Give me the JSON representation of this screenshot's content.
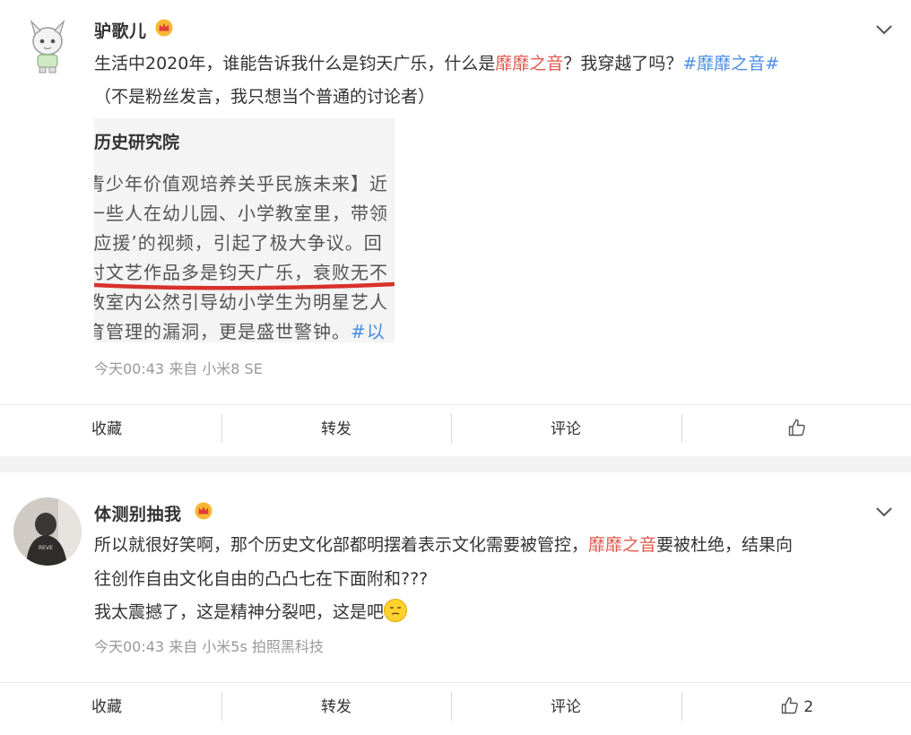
{
  "post1": {
    "username": "驴歌儿",
    "text_a": "生活中2020年，谁能告诉我什么是钧天广乐，什么是",
    "tag_inline": "靡靡之音",
    "text_b": "？我穿越了吗？",
    "hashtag": "#靡靡之音#",
    "line2": "（不是粉丝发言，我只想当个普通的讨论者）",
    "image": {
      "heading": "历史研究院",
      "lines": [
        "青少年价值观培养关乎民族未来】近",
        "一些人在幼儿园、小学教室里，带领",
        "‘应援’的视频，引起了极大争议。回",
        "讨文艺作品多是钧天广乐，衰败无不",
        "教室内公然引导幼小学生为明星艺人",
        "育管理的漏洞，更是盛世警钟。"
      ],
      "link_fragment": "#以"
    },
    "meta": "今天00:43  来自 小米8 SE",
    "actions": {
      "collect": "收藏",
      "forward": "转发",
      "comment": "评论",
      "like_count": ""
    }
  },
  "post2": {
    "username": "体测别抽我",
    "line1_a": "所以就很好笑啊，那个历史文化部都明摆着表示文化需要被管控，",
    "line1_tag": "靡靡之音",
    "line1_b": "要被杜绝，结果向",
    "line2": "往创作自由文化自由的凸凸七在下面附和???",
    "line3": "我太震撼了，这是精神分裂吧，这是吧",
    "meta": "今天00:43  来自 小米5s 拍照黑科技",
    "actions": {
      "collect": "收藏",
      "forward": "转发",
      "comment": "评论",
      "like_count": "2"
    }
  },
  "colors": {
    "tag": "#e0594f",
    "hashtag": "#4a8ee8",
    "meta": "#999999",
    "crown": "#f5a623"
  }
}
